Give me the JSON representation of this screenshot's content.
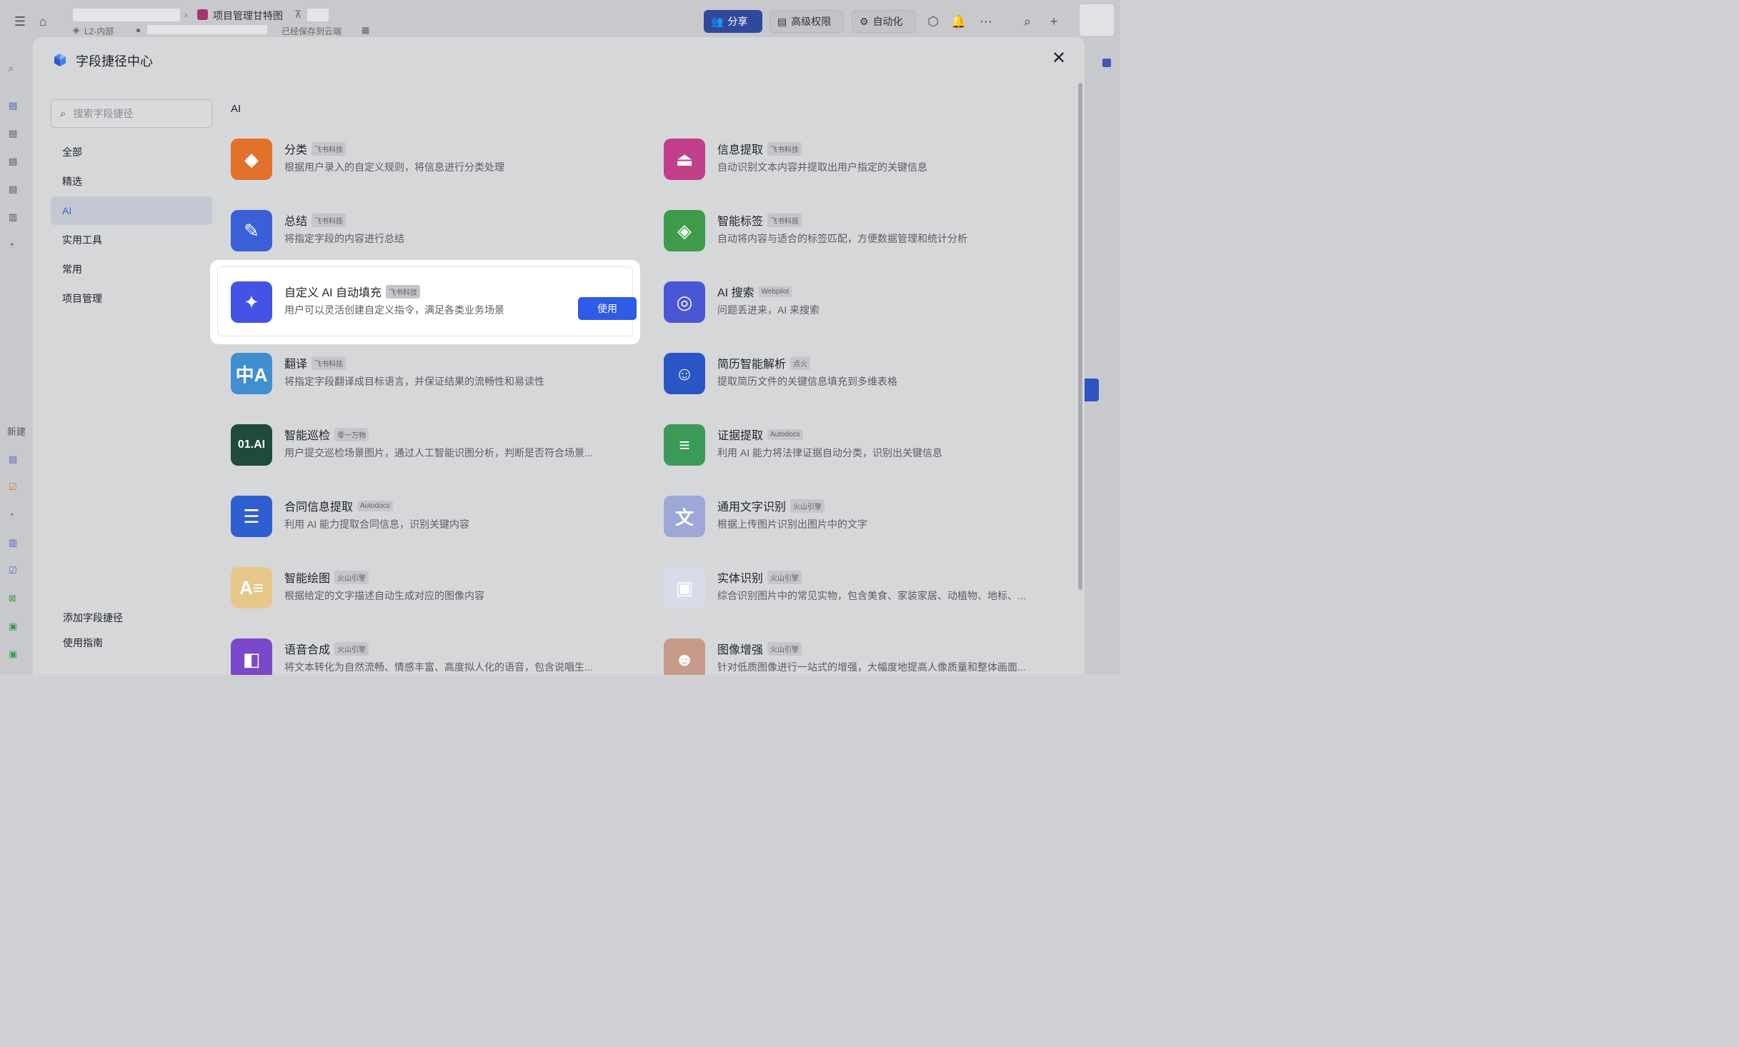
{
  "topbar": {
    "doc_title": "项目管理甘特图",
    "security_level": "L2-内部",
    "save_status": "已经保存到云端",
    "share_label": "分享",
    "advanced_perm_label": "高级权限",
    "automation_label": "自动化"
  },
  "leftrail": {
    "new_label": "新建"
  },
  "modal": {
    "title": "字段捷径中心",
    "search_placeholder": "搜索字段捷径",
    "nav": [
      {
        "label": "全部"
      },
      {
        "label": "精选"
      },
      {
        "label": "AI"
      },
      {
        "label": "实用工具"
      },
      {
        "label": "常用"
      },
      {
        "label": "项目管理"
      }
    ],
    "bottom_links": {
      "add": "添加字段捷径",
      "guide": "使用指南"
    },
    "section_title": "AI",
    "use_label": "使用",
    "cards": [
      {
        "title": "分类",
        "tag": "飞书科技",
        "desc": "根据用户录入的自定义规则，将信息进行分类处理",
        "icon": "category-icon",
        "color": "#e2712c"
      },
      {
        "title": "信息提取",
        "tag": "飞书科技",
        "desc": "自动识别文本内容并提取出用户指定的关键信息",
        "icon": "upload-tray-icon",
        "color": "#c13f8a"
      },
      {
        "title": "总结",
        "tag": "飞书科技",
        "desc": "将指定字段的内容进行总结",
        "icon": "summary-doc-icon",
        "color": "#3b5fd6"
      },
      {
        "title": "智能标签",
        "tag": "飞书科技",
        "desc": "自动将内容与适合的标签匹配，方便数据管理和统计分析",
        "icon": "tag-icon",
        "color": "#3e9b4a"
      },
      {
        "title": "自定义 AI 自动填充",
        "tag": "飞书科技",
        "desc": "用户可以灵活创建自定义指令，满足各类业务场景",
        "icon": "sparkle-icon",
        "color": "#4452e6"
      },
      {
        "title": "AI 搜索",
        "tag": "Webpilot",
        "desc": "问题丢进来，AI 来搜索",
        "icon": "webpilot-icon",
        "color": "#4a56d6"
      },
      {
        "title": "翻译",
        "tag": "飞书科技",
        "desc": "将指定字段翻译成目标语言，并保证结果的流畅性和易读性",
        "icon": "translate-icon",
        "color": "#3f8fd1"
      },
      {
        "title": "简历智能解析",
        "tag": "点火",
        "desc": "提取简历文件的关键信息填充到多维表格",
        "icon": "resume-icon",
        "color": "#2a55c7"
      },
      {
        "title": "智能巡检",
        "tag": "零一万物",
        "desc": "用户提交巡检场景图片，通过人工智能识图分析，判断是否符合场景...",
        "icon": "01ai-icon",
        "color": "#1f4a3e"
      },
      {
        "title": "证据提取",
        "tag": "Autodocs",
        "desc": "利用 AI 能力将法律证据自动分类，识别出关键信息",
        "icon": "evidence-icon",
        "color": "#3b9a58"
      },
      {
        "title": "合同信息提取",
        "tag": "Autodocs",
        "desc": "利用 AI 能力提取合同信息，识别关键内容",
        "icon": "contract-icon",
        "color": "#2f5ed1"
      },
      {
        "title": "通用文字识别",
        "tag": "火山引擎",
        "desc": "根据上传图片识别出图片中的文字",
        "icon": "ocr-icon",
        "color": "#9ea8d8"
      },
      {
        "title": "智能绘图",
        "tag": "火山引擎",
        "desc": "根据给定的文字描述自动生成对应的图像内容",
        "icon": "ai-draw-icon",
        "color": "#e8c88a"
      },
      {
        "title": "实体识别",
        "tag": "火山引擎",
        "desc": "综合识别图片中的常见实物，包含美食、家装家居、动植物、地标、...",
        "icon": "entity-icon",
        "color": "#d8dbe8"
      },
      {
        "title": "语音合成",
        "tag": "火山引擎",
        "desc": "将文本转化为自然流畅、情感丰富、高度拟人化的语音，包含说唱生...",
        "icon": "tts-icon",
        "color": "#7a48c8"
      },
      {
        "title": "图像增强",
        "tag": "火山引擎",
        "desc": "针对低质图像进行一站式的增强，大幅度地提高人像质量和整体画面...",
        "icon": "image-enhance-icon",
        "color": "#c89a8a"
      }
    ]
  }
}
